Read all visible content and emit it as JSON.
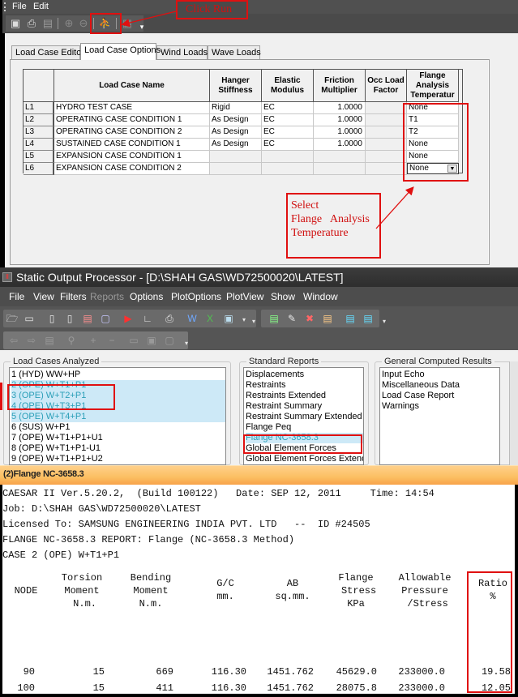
{
  "top_window": {
    "menu": [
      "File",
      "Edit"
    ],
    "toolbar_icons": [
      "save-icon",
      "print-icon",
      "print-preview-icon",
      "zoom-in-icon",
      "zoom-out-icon",
      "run-icon",
      "batch-run-icon"
    ],
    "tabs": [
      {
        "label": "Load Case Editor",
        "active": false
      },
      {
        "label": "Load Case Options",
        "active": true
      },
      {
        "label": "Wind Loads",
        "active": false
      },
      {
        "label": "Wave Loads",
        "active": false
      }
    ],
    "grid": {
      "headers": [
        "Load Case Name",
        "Hanger Stiffness",
        "Elastic Modulus",
        "Friction Multiplier",
        "Occ Load Factor",
        "Flange Analysis Temperatur"
      ],
      "rows": [
        {
          "id": "L1",
          "name": "HYDRO TEST CASE",
          "hanger": "Rigid",
          "elastic": "EC",
          "friction": "1.0000",
          "occ": "",
          "flange_temp": "None"
        },
        {
          "id": "L2",
          "name": "OPERATING CASE CONDITION 1",
          "hanger": "As Design",
          "elastic": "EC",
          "friction": "1.0000",
          "occ": "",
          "flange_temp": "T1"
        },
        {
          "id": "L3",
          "name": "OPERATING CASE CONDITION 2",
          "hanger": "As Design",
          "elastic": "EC",
          "friction": "1.0000",
          "occ": "",
          "flange_temp": "T2"
        },
        {
          "id": "L4",
          "name": "SUSTAINED CASE CONDITION 1",
          "hanger": "As Design",
          "elastic": "EC",
          "friction": "1.0000",
          "occ": "",
          "flange_temp": "None"
        },
        {
          "id": "L5",
          "name": "EXPANSION CASE CONDITION 1",
          "hanger": "",
          "elastic": "",
          "friction": "",
          "occ": "",
          "flange_temp": "None"
        },
        {
          "id": "L6",
          "name": "EXPANSION CASE CONDITION 2",
          "hanger": "",
          "elastic": "",
          "friction": "",
          "occ": "",
          "flange_temp": "None"
        }
      ]
    }
  },
  "annotations": {
    "click_run": "Click Run",
    "select_flange": [
      "Select",
      "Flange   Analysis",
      "Temperature"
    ],
    "color": "#e01010"
  },
  "output_processor": {
    "title": "Static Output Processor - [D:\\SHAH GAS\\WD72500020\\LATEST]",
    "menu": [
      {
        "label": "File",
        "enabled": true
      },
      {
        "label": "View",
        "enabled": true
      },
      {
        "label": "Filters",
        "enabled": true
      },
      {
        "label": "Reports",
        "enabled": false
      },
      {
        "label": "Options",
        "enabled": true
      },
      {
        "label": "PlotOptions",
        "enabled": true
      },
      {
        "label": "PlotView",
        "enabled": true
      },
      {
        "label": "Show",
        "enabled": true
      },
      {
        "label": "Window",
        "enabled": true
      }
    ],
    "load_cases_title": "Load Cases Analyzed",
    "load_cases": [
      {
        "label": "1 (HYD) WW+HP",
        "selected": false
      },
      {
        "label": "2 (OPE) W+T1+P1",
        "selected": true
      },
      {
        "label": "3 (OPE) W+T2+P1",
        "selected": true
      },
      {
        "label": "4 (OPE) W+T3+P1",
        "selected": true
      },
      {
        "label": "5 (OPE) W+T4+P1",
        "selected": true
      },
      {
        "label": "6 (SUS) W+P1",
        "selected": false
      },
      {
        "label": "7 (OPE) W+T1+P1+U1",
        "selected": false
      },
      {
        "label": "8 (OPE) W+T1+P1-U1",
        "selected": false
      },
      {
        "label": "9 (OPE) W+T1+P1+U2",
        "selected": false
      }
    ],
    "standard_reports_title": "Standard Reports",
    "standard_reports": [
      {
        "label": "Displacements",
        "selected": false
      },
      {
        "label": "Restraints",
        "selected": false
      },
      {
        "label": "Restraints Extended",
        "selected": false
      },
      {
        "label": "Restraint Summary",
        "selected": false
      },
      {
        "label": "Restraint Summary Extended",
        "selected": false
      },
      {
        "label": "Flange Peq",
        "selected": false
      },
      {
        "label": "Flange NC-3658.3",
        "selected": true
      },
      {
        "label": "Global Element Forces",
        "selected": false
      },
      {
        "label": "Global Element Forces Extended",
        "selected": false
      }
    ],
    "general_results_title": "General Computed Results",
    "general_results": [
      "Input Echo",
      "Miscellaneous Data",
      "Load Case Report",
      "Warnings"
    ],
    "report_tab": "(2)Flange NC-3658.3",
    "report": {
      "lines": [
        "CAESAR II Ver.5.20.2,  (Build 100122)   Date: SEP 12, 2011     Time: 14:54",
        "Job: D:\\SHAH GAS\\WD72500020\\LATEST",
        "Licensed To: SAMSUNG ENGINEERING INDIA PVT. LTD   --  ID #24505",
        "FLANGE NC-3658.3 REPORT: Flange (NC-3658.3 Method)",
        "CASE 2 (OPE) W+T1+P1"
      ],
      "columns": [
        "NODE",
        "Torsion\nMoment\n N.m.",
        "Bending\nMoment\nN.m.",
        "G/C\nmm.",
        "AB\nsq.mm.",
        "Flange\n Stress\nKPa",
        "Allowable\nPressure\n /Stress",
        "Ratio\n%"
      ],
      "rows": [
        [
          "90",
          "15",
          "669",
          "116.30",
          "1451.762",
          "45629.0",
          "233000.0",
          "19.58"
        ],
        [
          "100",
          "15",
          "411",
          "116.30",
          "1451.762",
          "28075.8",
          "233000.0",
          "12.05"
        ]
      ]
    }
  }
}
